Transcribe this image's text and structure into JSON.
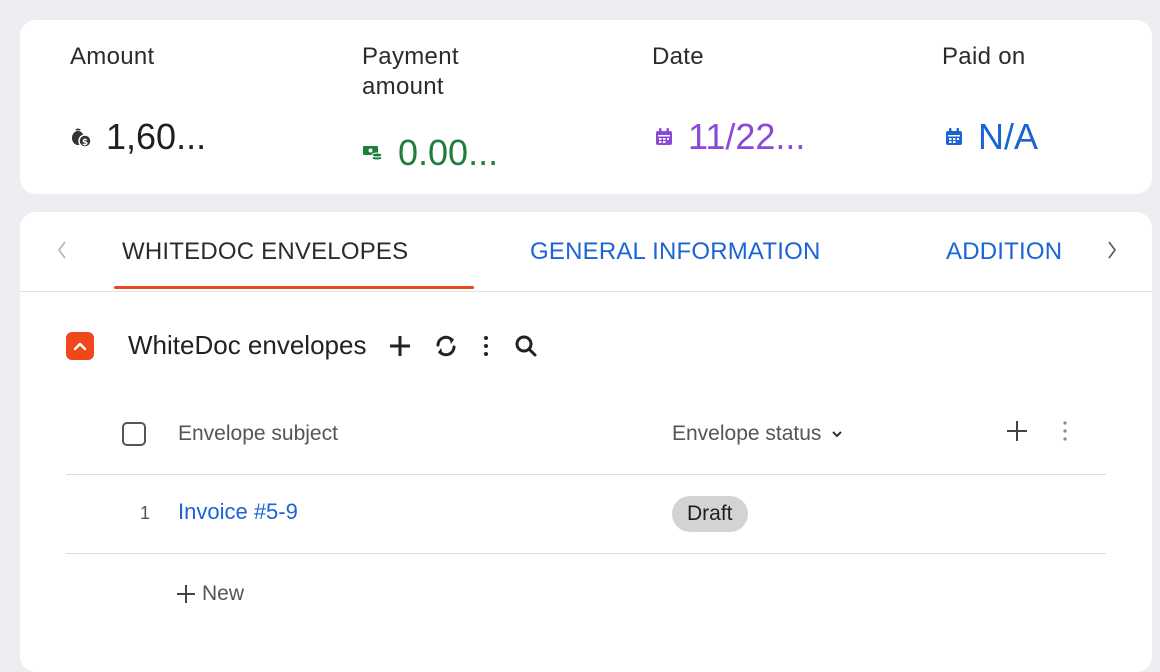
{
  "summary": {
    "amount": {
      "label": "Amount",
      "value": "1,60..."
    },
    "payment_amount": {
      "label": "Payment amount",
      "value": "0.00..."
    },
    "date": {
      "label": "Date",
      "value": "11/22..."
    },
    "paid_on": {
      "label": "Paid on",
      "value": "N/A"
    }
  },
  "tabs": [
    {
      "label": "WHITEDOC ENVELOPES",
      "active": true
    },
    {
      "label": "GENERAL INFORMATION",
      "active": false
    },
    {
      "label": "ADDITION",
      "active": false
    }
  ],
  "section": {
    "title": "WhiteDoc envelopes",
    "icons": [
      "add-icon",
      "refresh-icon",
      "more-vertical-icon",
      "search-icon"
    ]
  },
  "table": {
    "columns": [
      "Envelope subject",
      "Envelope status"
    ],
    "rows": [
      {
        "num": "1",
        "subject": "Invoice #5-9",
        "status": "Draft"
      }
    ],
    "new_label": "New"
  },
  "colors": {
    "accent_orange": "#f0481d",
    "link_blue": "#1a64d6",
    "money_green": "#1e7f3a",
    "date_purple": "#8b49d8"
  }
}
